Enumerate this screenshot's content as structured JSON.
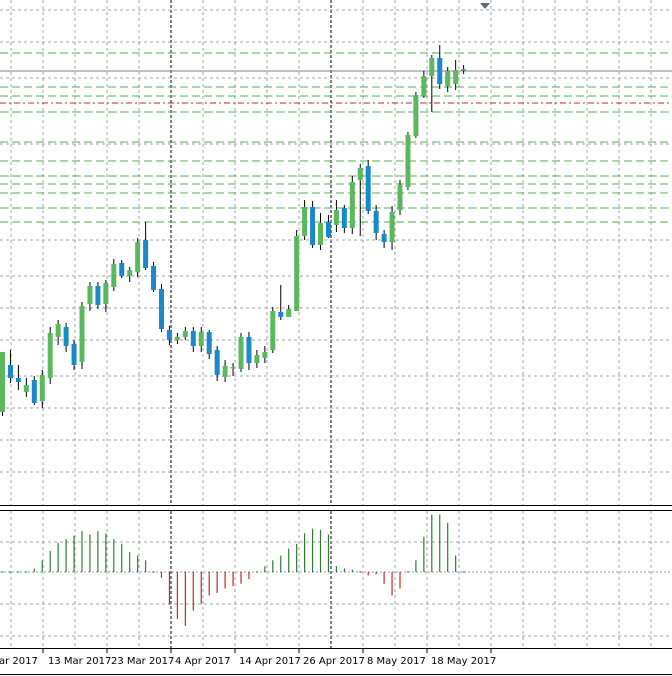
{
  "chart_data": [
    {
      "type": "candlestick",
      "title": "",
      "x": [
        "2017-03-01",
        "2017-03-02",
        "2017-03-03",
        "2017-03-06",
        "2017-03-07",
        "2017-03-08",
        "2017-03-09",
        "2017-03-10",
        "2017-03-13",
        "2017-03-14",
        "2017-03-15",
        "2017-03-16",
        "2017-03-17",
        "2017-03-20",
        "2017-03-21",
        "2017-03-22",
        "2017-03-23",
        "2017-03-24",
        "2017-03-27",
        "2017-03-28",
        "2017-03-29",
        "2017-03-30",
        "2017-03-31",
        "2017-04-03",
        "2017-04-04",
        "2017-04-05",
        "2017-04-06",
        "2017-04-07",
        "2017-04-10",
        "2017-04-11",
        "2017-04-12",
        "2017-04-13",
        "2017-04-14",
        "2017-04-17",
        "2017-04-18",
        "2017-04-19",
        "2017-04-20",
        "2017-04-21",
        "2017-04-24",
        "2017-04-25",
        "2017-04-26",
        "2017-04-27",
        "2017-04-28",
        "2017-05-01",
        "2017-05-02",
        "2017-05-03",
        "2017-05-04",
        "2017-05-05",
        "2017-05-08",
        "2017-05-09",
        "2017-05-10",
        "2017-05-11",
        "2017-05-12",
        "2017-05-15",
        "2017-05-16",
        "2017-05-17",
        "2017-05-18",
        "2017-05-19",
        "2017-05-22"
      ],
      "ohlc": [
        [
          412,
          352,
          416,
          360
        ],
        [
          365,
          378,
          350,
          383
        ],
        [
          378,
          382,
          365,
          390
        ],
        [
          392,
          385,
          378,
          397
        ],
        [
          380,
          403,
          376,
          405
        ],
        [
          401,
          375,
          370,
          408
        ],
        [
          378,
          333,
          327,
          384
        ],
        [
          337,
          324,
          320,
          345
        ],
        [
          327,
          346,
          323,
          352
        ],
        [
          344,
          365,
          340,
          370
        ],
        [
          362,
          306,
          302,
          369
        ],
        [
          304,
          286,
          282,
          311
        ],
        [
          286,
          305,
          282,
          309
        ],
        [
          304,
          283,
          280,
          312
        ],
        [
          287,
          264,
          259,
          291
        ],
        [
          263,
          276,
          260,
          278
        ],
        [
          276,
          270,
          267,
          282
        ],
        [
          272,
          242,
          238,
          277
        ],
        [
          240,
          268,
          222,
          270
        ],
        [
          266,
          290,
          262,
          292
        ],
        [
          289,
          329,
          284,
          332
        ],
        [
          330,
          340,
          326,
          345
        ],
        [
          340,
          337,
          333,
          344
        ],
        [
          337,
          331,
          327,
          340
        ],
        [
          331,
          346,
          327,
          352
        ],
        [
          346,
          332,
          327,
          352
        ],
        [
          332,
          354,
          330,
          359
        ],
        [
          350,
          375,
          346,
          381
        ],
        [
          377,
          366,
          360,
          382
        ],
        [
          368,
          367,
          363,
          376
        ],
        [
          369,
          337,
          333,
          372
        ],
        [
          337,
          363,
          332,
          370
        ],
        [
          363,
          355,
          350,
          368
        ],
        [
          358,
          352,
          346,
          363
        ],
        [
          350,
          311,
          307,
          353
        ],
        [
          312,
          317,
          285,
          320
        ],
        [
          317,
          309,
          305,
          314
        ],
        [
          311,
          236,
          230,
          261
        ],
        [
          236,
          207,
          200,
          240
        ],
        [
          207,
          245,
          201,
          248
        ],
        [
          245,
          223,
          213,
          250
        ],
        [
          222,
          237,
          215,
          238
        ],
        [
          225,
          210,
          200,
          232
        ],
        [
          208,
          228,
          205,
          233
        ],
        [
          228,
          182,
          176,
          234
        ],
        [
          180,
          168,
          164,
          236
        ],
        [
          166,
          211,
          160,
          214
        ],
        [
          211,
          233,
          205,
          240
        ],
        [
          234,
          242,
          230,
          248
        ],
        [
          242,
          212,
          206,
          250
        ],
        [
          210,
          185,
          180,
          215
        ],
        [
          187,
          135,
          132,
          190
        ],
        [
          136,
          95,
          92,
          138
        ],
        [
          96,
          76,
          71,
          98
        ],
        [
          76,
          58,
          55,
          112
        ],
        [
          58,
          84,
          45,
          89
        ],
        [
          86,
          71,
          67,
          92
        ],
        [
          84,
          70,
          60,
          90
        ],
        [
          70,
          69,
          65,
          74
        ]
      ],
      "up_color": "#5cb85c",
      "down_color": "#1a88c9",
      "price_lines": [
        {
          "color": "#4caf50",
          "style": "dashed"
        },
        {
          "color": "#4caf50",
          "style": "dashed"
        },
        {
          "color": "#4caf50",
          "style": "dashed"
        },
        {
          "color": "#c62828",
          "style": "dash-dot"
        },
        {
          "color": "#4caf50",
          "style": "dashed"
        },
        {
          "color": "#4caf50",
          "style": "dashed"
        },
        {
          "color": "#4caf50",
          "style": "dashed"
        },
        {
          "color": "#4caf50",
          "style": "dashed"
        },
        {
          "color": "#4caf50",
          "style": "dashed"
        },
        {
          "color": "#4caf50",
          "style": "dashed"
        },
        {
          "color": "#4caf50",
          "style": "dashed"
        },
        {
          "color": "#4caf50",
          "style": "dashed"
        }
      ],
      "current_price_line": {
        "color": "#808080",
        "style": "solid"
      },
      "ylim": [
        0,
        505
      ],
      "grid": true
    },
    {
      "type": "bar",
      "title": "",
      "values": [
        0,
        0,
        0,
        0,
        3,
        10,
        18,
        25,
        28,
        31,
        35,
        32,
        35,
        33,
        28,
        24,
        17,
        14,
        10,
        0,
        -5,
        -28,
        -40,
        -46,
        -33,
        -27,
        -20,
        -18,
        -14,
        -12,
        -10,
        -6,
        0,
        5,
        10,
        14,
        20,
        24,
        33,
        37,
        36,
        32,
        5,
        3,
        2,
        0,
        -3,
        -2,
        -10,
        -20,
        -14,
        0,
        10,
        30,
        49,
        49,
        42,
        14,
        0
      ],
      "up_color": "#2e7d32",
      "down_color": "#c62828",
      "ylim": [
        -50,
        52
      ],
      "grid": true
    }
  ],
  "x_axis": {
    "tick_labels": [
      "ar 2017",
      "13 Mar 2017",
      "23 Mar 2017",
      "4 Apr 2017",
      "14 Apr 2017",
      "26 Apr 2017",
      "8 May 2017",
      "18 May 2017"
    ]
  },
  "colors": {
    "background": "#ffffff",
    "grid": "#a0a0a0",
    "axis": "#000000",
    "marker": "#5f6b78"
  },
  "icons": {
    "scroll_marker": "triangle-down-icon"
  }
}
